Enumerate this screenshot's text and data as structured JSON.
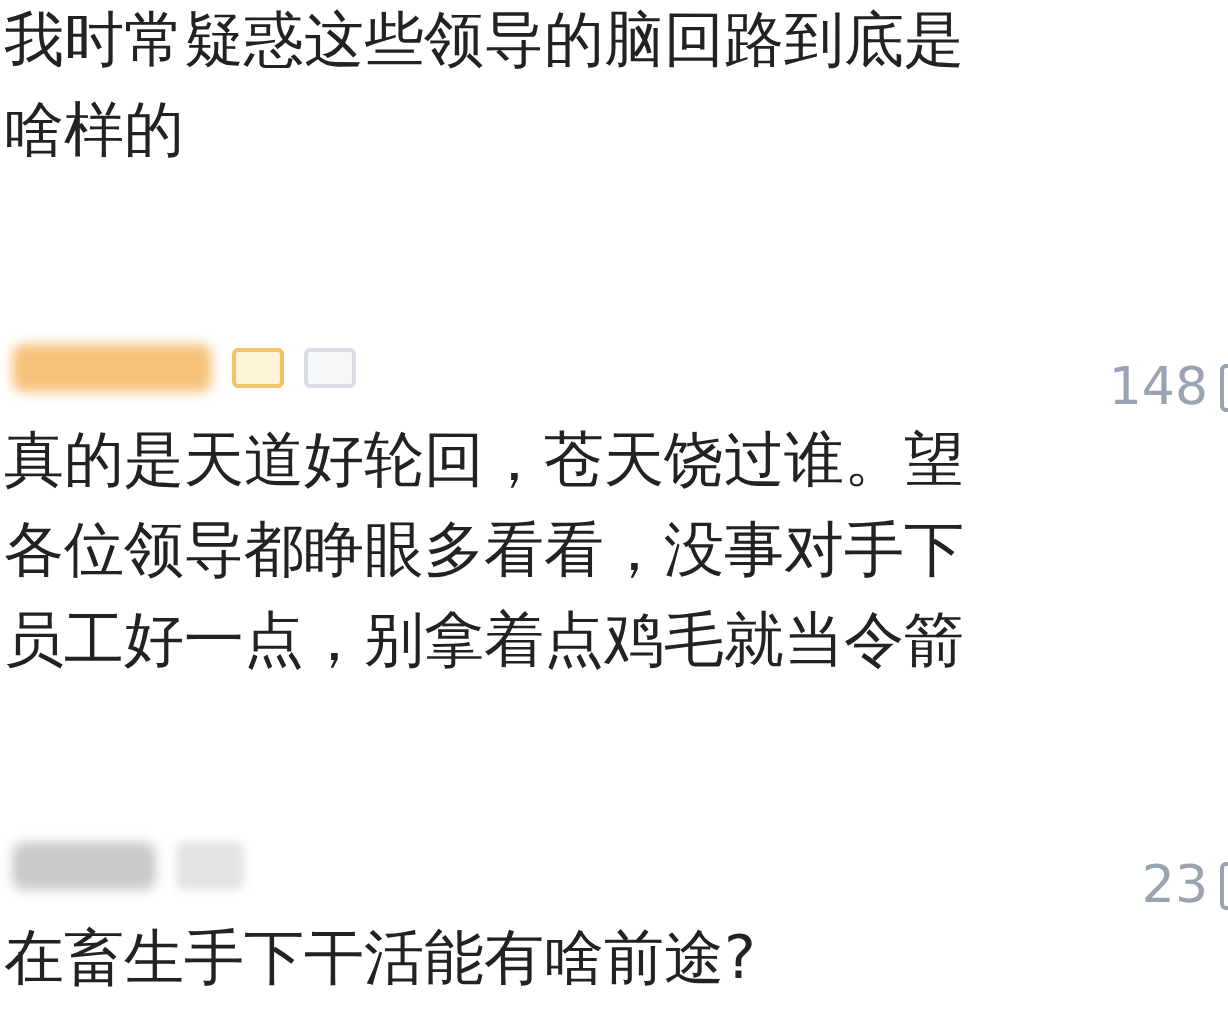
{
  "comments": [
    {
      "text": "我时常疑惑这些领导的脑回路到底是啥样的"
    },
    {
      "author": {
        "kind": "blurred",
        "badges": [
          {
            "kind": "level"
          },
          {
            "kind": "id"
          }
        ]
      },
      "likes": "148",
      "text": "真的是天道好轮回，苍天饶过谁。望各位领导都睁眼多看看，没事对手下员工好一点，别拿着点鸡毛就当令箭"
    },
    {
      "author": {
        "kind": "blurred",
        "badges": [
          {
            "kind": "blurred"
          }
        ]
      },
      "likes": "23",
      "text": "在畜生手下干活能有啥前途?"
    }
  ]
}
